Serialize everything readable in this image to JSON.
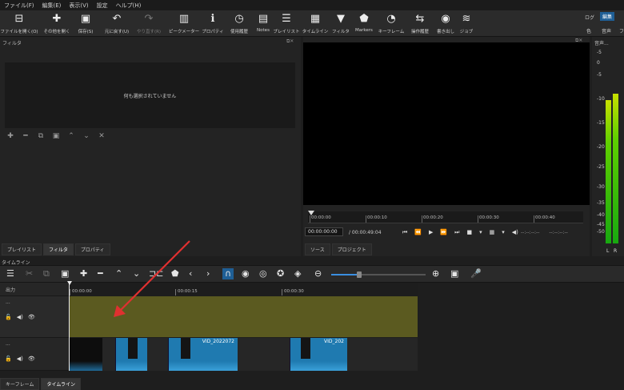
{
  "menubar": [
    "ファイル(F)",
    "編集(E)",
    "表示(V)",
    "設定",
    "ヘルプ(H)"
  ],
  "toolbar": [
    {
      "label": "ファイルを開く(O)",
      "icon": "open-file-icon",
      "glyph": "⊟"
    },
    {
      "label": "その他を開く",
      "icon": "open-other-icon",
      "glyph": "✚"
    },
    {
      "label": "保存(S)",
      "icon": "save-icon",
      "glyph": "▣"
    },
    {
      "label": "元に戻す(U)",
      "icon": "undo-icon",
      "glyph": "↶"
    },
    {
      "label": "やり直す(R)",
      "icon": "redo-icon",
      "glyph": "↷"
    },
    {
      "label": "ピークメーター",
      "icon": "peak-meter-icon",
      "glyph": "▥"
    },
    {
      "label": "プロパティ",
      "icon": "info-icon",
      "glyph": "ℹ"
    },
    {
      "label": "使用履歴",
      "icon": "clock-icon",
      "glyph": "◷"
    },
    {
      "label": "Notes",
      "icon": "notes-icon",
      "glyph": "▤"
    },
    {
      "label": "プレイリスト",
      "icon": "playlist-icon",
      "glyph": "☰"
    },
    {
      "label": "タイムライン",
      "icon": "timeline-icon",
      "glyph": "▦"
    },
    {
      "label": "フィルタ",
      "icon": "filter-icon",
      "glyph": "▼"
    },
    {
      "label": "Markers",
      "icon": "marker-icon",
      "glyph": "⬟"
    },
    {
      "label": "キーフレーム",
      "icon": "stopwatch-icon",
      "glyph": "◔"
    },
    {
      "label": "操作履歴",
      "icon": "history-icon",
      "glyph": "⇆"
    },
    {
      "label": "書き出し",
      "icon": "export-icon",
      "glyph": "◉"
    },
    {
      "label": "ジョブ",
      "icon": "jobs-icon",
      "glyph": "≋"
    }
  ],
  "layout_tabs": {
    "log": "ログ",
    "edit": "編集",
    "color": "色",
    "audio": "音声",
    "more": "フ"
  },
  "filter_panel": {
    "title": "フィルタ",
    "empty_message": "何も選択されていません",
    "tools": [
      "✚",
      "━",
      "⧉",
      "▣",
      "⌃",
      "⌄",
      "✕"
    ],
    "tabs": [
      "プレイリスト",
      "フィルタ",
      "プロパティ"
    ]
  },
  "player": {
    "ruler_ticks": [
      "00:00:00",
      "00:00:10",
      "00:00:20",
      "00:00:30",
      "00:00:40"
    ],
    "timecode": "00:00:00:00",
    "total": "/ 00:00:49:04",
    "in_point": "--:--:--:--",
    "out_point": "--:--:--:--",
    "transport": [
      "⏮",
      "⏪",
      "▶",
      "⏩",
      "⏭",
      "■",
      "▾",
      "▦",
      "▾",
      "◀)"
    ],
    "tabs": [
      "ソース",
      "プロジェクト"
    ]
  },
  "meter": {
    "title": "音声...",
    "labels": [
      "-5",
      "0",
      "-5",
      "-10",
      "-15",
      "-20",
      "-25",
      "-30",
      "-35",
      "-40",
      "-45",
      "-50"
    ],
    "left_label": "L",
    "right_label": "R",
    "left_level": 0.82,
    "right_level": 0.86
  },
  "timeline": {
    "title": "タイムライン",
    "tools": [
      "☰",
      "✂",
      "⧉",
      "▣",
      "✚",
      "━",
      "⌃",
      "⌄",
      "⊐⊏",
      "⬟",
      "‹",
      "›",
      "∩",
      "◉",
      "◎",
      "✪",
      "◈",
      "⊖",
      "⊕",
      "▣",
      "🎤"
    ],
    "zoom_level": 0.3,
    "output_label": "出力",
    "ruler_ticks": [
      "00:00:00",
      "00:00:15",
      "00:00:30"
    ],
    "tracks": [
      {
        "name": "...",
        "icons": [
          "🔓",
          "◀)",
          "👁"
        ]
      },
      {
        "name": "...",
        "icons": [
          "🔓",
          "◀)",
          "👁"
        ]
      }
    ],
    "clips": [
      {
        "name": ""
      },
      {
        "name": ""
      },
      {
        "name": "VID_2022072"
      },
      {
        "name": "VID_202"
      }
    ],
    "bottom_tabs": [
      "キーフレーム",
      "タイムライン"
    ]
  },
  "colors": {
    "accent": "#1f7ab0",
    "track_highlight": "#5b5a20",
    "arrow": "#e03030"
  }
}
